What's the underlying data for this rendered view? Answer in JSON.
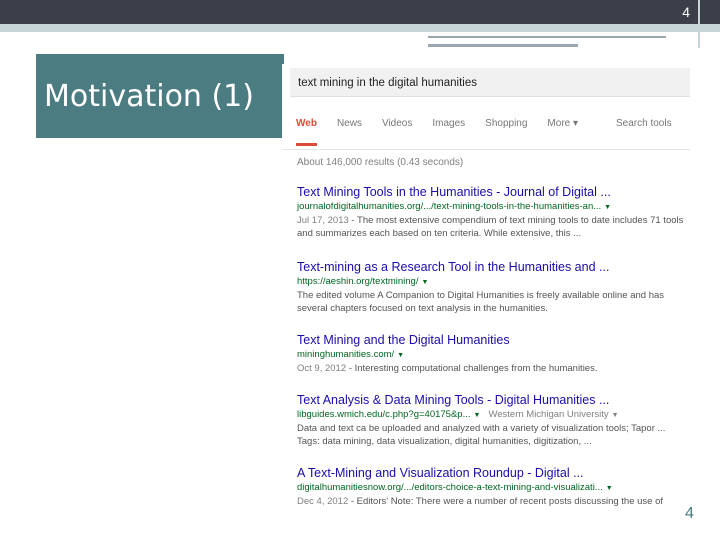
{
  "slide": {
    "title": "Motivation (1)",
    "number_top": "4",
    "number_bottom": "4"
  },
  "search": {
    "query": "text mining in the digital humanities",
    "tabs": [
      {
        "label": "Web",
        "active": true
      },
      {
        "label": "News",
        "active": false
      },
      {
        "label": "Videos",
        "active": false
      },
      {
        "label": "Images",
        "active": false
      },
      {
        "label": "Shopping",
        "active": false
      },
      {
        "label": "More ▾",
        "active": false
      }
    ],
    "tools_label": "Search tools",
    "stats": "About 146,000 results (0.43 seconds)"
  },
  "results": [
    {
      "title": "Text Mining Tools in the Humanities - Journal of Digital ...",
      "url": "journalofdigitalhumanities.org/.../text-mining-tools-in-the-humanities-an...",
      "date": "Jul 17, 2013",
      "snippet": " - The most extensive compendium of text mining tools to date includes 71 tools and summarizes each based on ten criteria. While extensive, this ..."
    },
    {
      "title": "Text-mining as a Research Tool in the Humanities and ...",
      "url": "https://aeshin.org/textmining/",
      "date": "",
      "snippet": "The edited volume A Companion to Digital Humanities is freely available online and has several chapters focused on text analysis in the humanities."
    },
    {
      "title": "Text Mining and the Digital Humanities",
      "url": "mininghumanities.com/",
      "date": "Oct 9, 2012",
      "snippet": " - Interesting computational challenges from the humanities."
    },
    {
      "title": "Text Analysis & Data Mining Tools - Digital Humanities ...",
      "url": "libguides.wmich.edu/c.php?g=40175&p...",
      "url_extra": "Western Michigan University",
      "date": "",
      "snippet": "Data and text ca be uploaded and analyzed with a variety of visualization tools; Tapor ...",
      "tags": "Tags: data mining, data visualization, digital humanities, digitization, ..."
    },
    {
      "title": "A Text-Mining and Visualization Roundup - Digital ...",
      "url": "digitalhumanitiesnow.org/.../editors-choice-a-text-mining-and-visualizati...",
      "date": "Dec 4, 2012",
      "snippet": " - Editors' Note: There were a number of recent posts discussing the use of"
    }
  ]
}
